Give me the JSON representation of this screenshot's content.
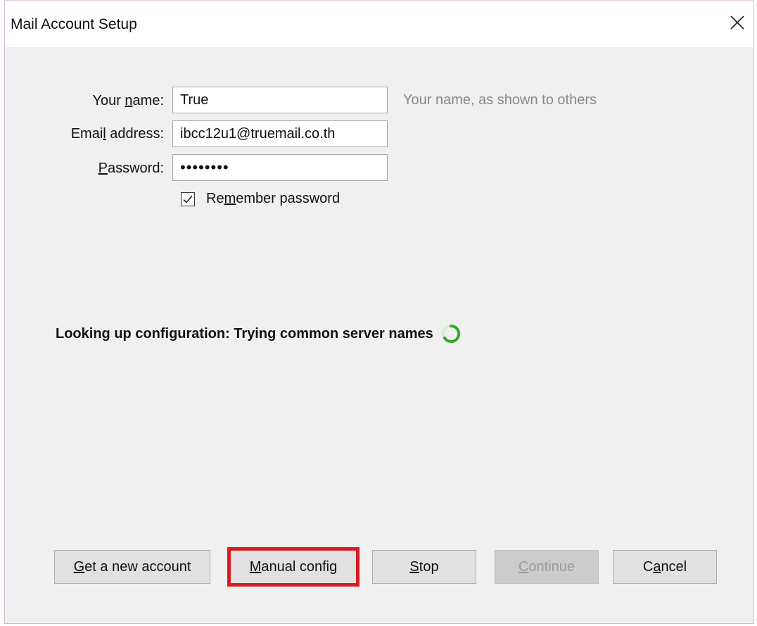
{
  "window": {
    "title": "Mail Account Setup"
  },
  "form": {
    "name": {
      "label_pre": "Your ",
      "label_key": "n",
      "label_post": "ame:",
      "value": "True",
      "hint": "Your name, as shown to others"
    },
    "email": {
      "label_pre": "Emai",
      "label_key": "l",
      "label_post": " address:",
      "value": "ibcc12u1@truemail.co.th"
    },
    "password": {
      "label_pre": "",
      "label_key": "P",
      "label_post": "assword:",
      "value": "••••••••"
    },
    "remember": {
      "label_pre": "Re",
      "label_key": "m",
      "label_post": "ember password",
      "checked": true
    }
  },
  "status": {
    "text": "Looking up configuration: Trying common server names"
  },
  "buttons": {
    "new_account": {
      "pre": "",
      "key": "G",
      "post": "et a new account"
    },
    "manual_config": {
      "pre": "",
      "key": "M",
      "post": "anual config"
    },
    "stop": {
      "pre": "",
      "key": "S",
      "post": "top"
    },
    "continue": {
      "pre": "",
      "key": "C",
      "post": "ontinue",
      "disabled": true
    },
    "cancel": {
      "pre": "C",
      "key": "a",
      "post": "ncel"
    }
  },
  "colors": {
    "highlight": "#d81b23",
    "spinner": "#36a52a"
  },
  "icons": {
    "close": "close-icon",
    "spinner": "loading-spinner-icon",
    "check": "check-icon"
  }
}
